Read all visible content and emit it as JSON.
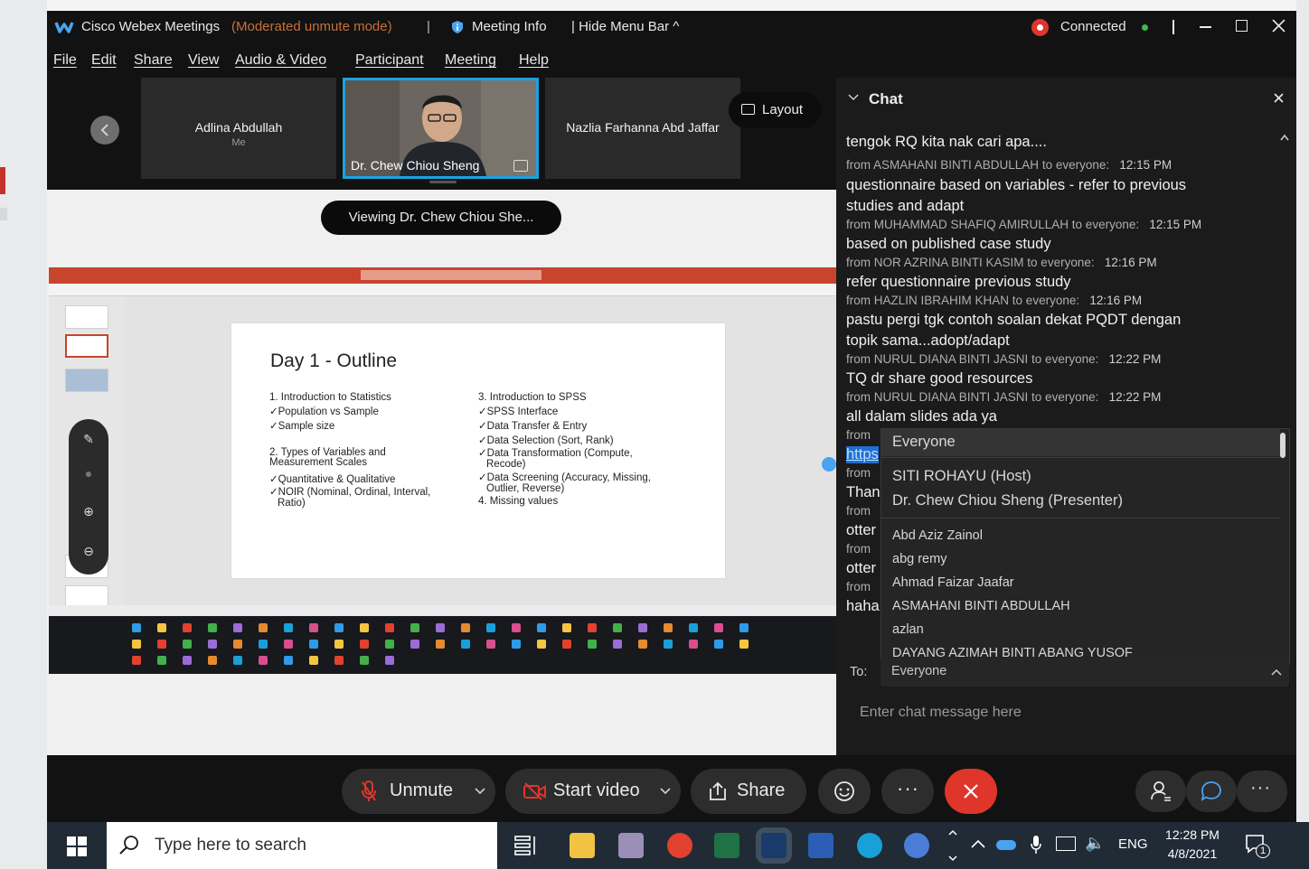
{
  "window": {
    "app_title": "Cisco Webex Meetings",
    "mode": "(Moderated unmute mode)",
    "separator": "|",
    "meeting_info": "Meeting Info",
    "hide_menu_bar": "| Hide Menu Bar ^",
    "connection_status": "Connected"
  },
  "menu": [
    "File",
    "Edit",
    "Share",
    "View",
    "Audio & Video",
    "Participant",
    "Meeting",
    "Help"
  ],
  "filmstrip": {
    "participants": [
      {
        "name": "Adlina Abdullah",
        "sub": "Me"
      },
      {
        "name": "Dr. Chew Chiou Sheng"
      },
      {
        "name": "Nazlia Farhanna Abd Jaffar"
      }
    ],
    "layout_label": "Layout"
  },
  "share": {
    "viewing_label": "Viewing Dr. Chew Chiou She..."
  },
  "slide": {
    "title": "Day 1 - Outline",
    "left_items": [
      "1. Introduction to Statistics",
      "✓Population vs Sample",
      "✓Sample size",
      "",
      "2. Types of Variables and",
      "Measurement Scales",
      "✓Quantitative & Qualitative",
      "✓NOIR (Nominal, Ordinal, Interval,",
      "Ratio)"
    ],
    "right_items": [
      "3. Introduction to SPSS",
      "✓SPSS Interface",
      "✓Data Transfer & Entry",
      "✓Data Selection (Sort, Rank)",
      "✓Data Transformation (Compute,",
      "Recode)",
      "✓Data Screening (Accuracy, Missing,",
      "Outlier, Reverse)",
      "4. Missing values"
    ]
  },
  "chat": {
    "title": "Chat",
    "messages": [
      {
        "type": "text",
        "text": "tengok RQ kita nak cari apa...."
      },
      {
        "type": "from",
        "sender": "from ASMAHANI BINTI ABDULLAH",
        "to": "to everyone:",
        "time": "12:15 PM"
      },
      {
        "type": "text",
        "text": "questionnaire based on variables - refer to previous"
      },
      {
        "type": "text",
        "text": "studies and adapt"
      },
      {
        "type": "from",
        "sender": "from MUHAMMAD SHAFIQ AMIRULLAH",
        "to": "to everyone:",
        "time": "12:15 PM"
      },
      {
        "type": "text",
        "text": "based on published case study"
      },
      {
        "type": "from",
        "sender": "from NOR AZRINA BINTI KASIM",
        "to": "to everyone:",
        "time": "12:16 PM"
      },
      {
        "type": "text",
        "text": "refer questionnaire previous study"
      },
      {
        "type": "from",
        "sender": "from HAZLIN IBRAHIM KHAN",
        "to": "to everyone:",
        "time": "12:16 PM"
      },
      {
        "type": "text",
        "text": "pastu pergi tgk contoh soalan dekat PQDT dengan"
      },
      {
        "type": "text",
        "text": "topik sama...adopt/adapt"
      },
      {
        "type": "from",
        "sender": "from NURUL DIANA BINTI JASNI",
        "to": "to everyone:",
        "time": "12:22 PM"
      },
      {
        "type": "text",
        "text": "TQ dr share good resources"
      },
      {
        "type": "from",
        "sender": "from NURUL DIANA BINTI JASNI",
        "to": "to everyone:",
        "time": "12:22 PM"
      },
      {
        "type": "text",
        "text": "all dalam slides ada ya"
      }
    ],
    "partial_left": [
      "from",
      "https",
      "from",
      "Than",
      "from",
      "otter",
      "from",
      "otter",
      "from",
      "haha"
    ],
    "dropdown": {
      "selected": "Everyone",
      "options": [
        "SITI ROHAYU (Host)",
        "Dr. Chew Chiou Sheng (Presenter)",
        "Abd Aziz Zainol",
        "abg remy",
        "Ahmad Faizar Jaafar",
        "ASMAHANI BINTI ABDULLAH",
        "azlan",
        "DAYANG AZIMAH BINTI ABANG YUSOF"
      ]
    },
    "to_label": "To:",
    "to_value": "Everyone",
    "input_placeholder": "Enter chat message here"
  },
  "controls": {
    "unmute": "Unmute",
    "start_video": "Start video",
    "share": "Share"
  },
  "taskbar": {
    "search_placeholder": "Type here to search",
    "language": "ENG",
    "time": "12:28 PM",
    "date": "4/8/2021",
    "notification_count": "1"
  },
  "colors": {
    "accent_blue": "#4aa3f0",
    "leave_red": "#e0352b",
    "connected_green": "#3fb950",
    "mode_orange": "#c6703a",
    "ppt_ribbon": "#c8442c"
  }
}
